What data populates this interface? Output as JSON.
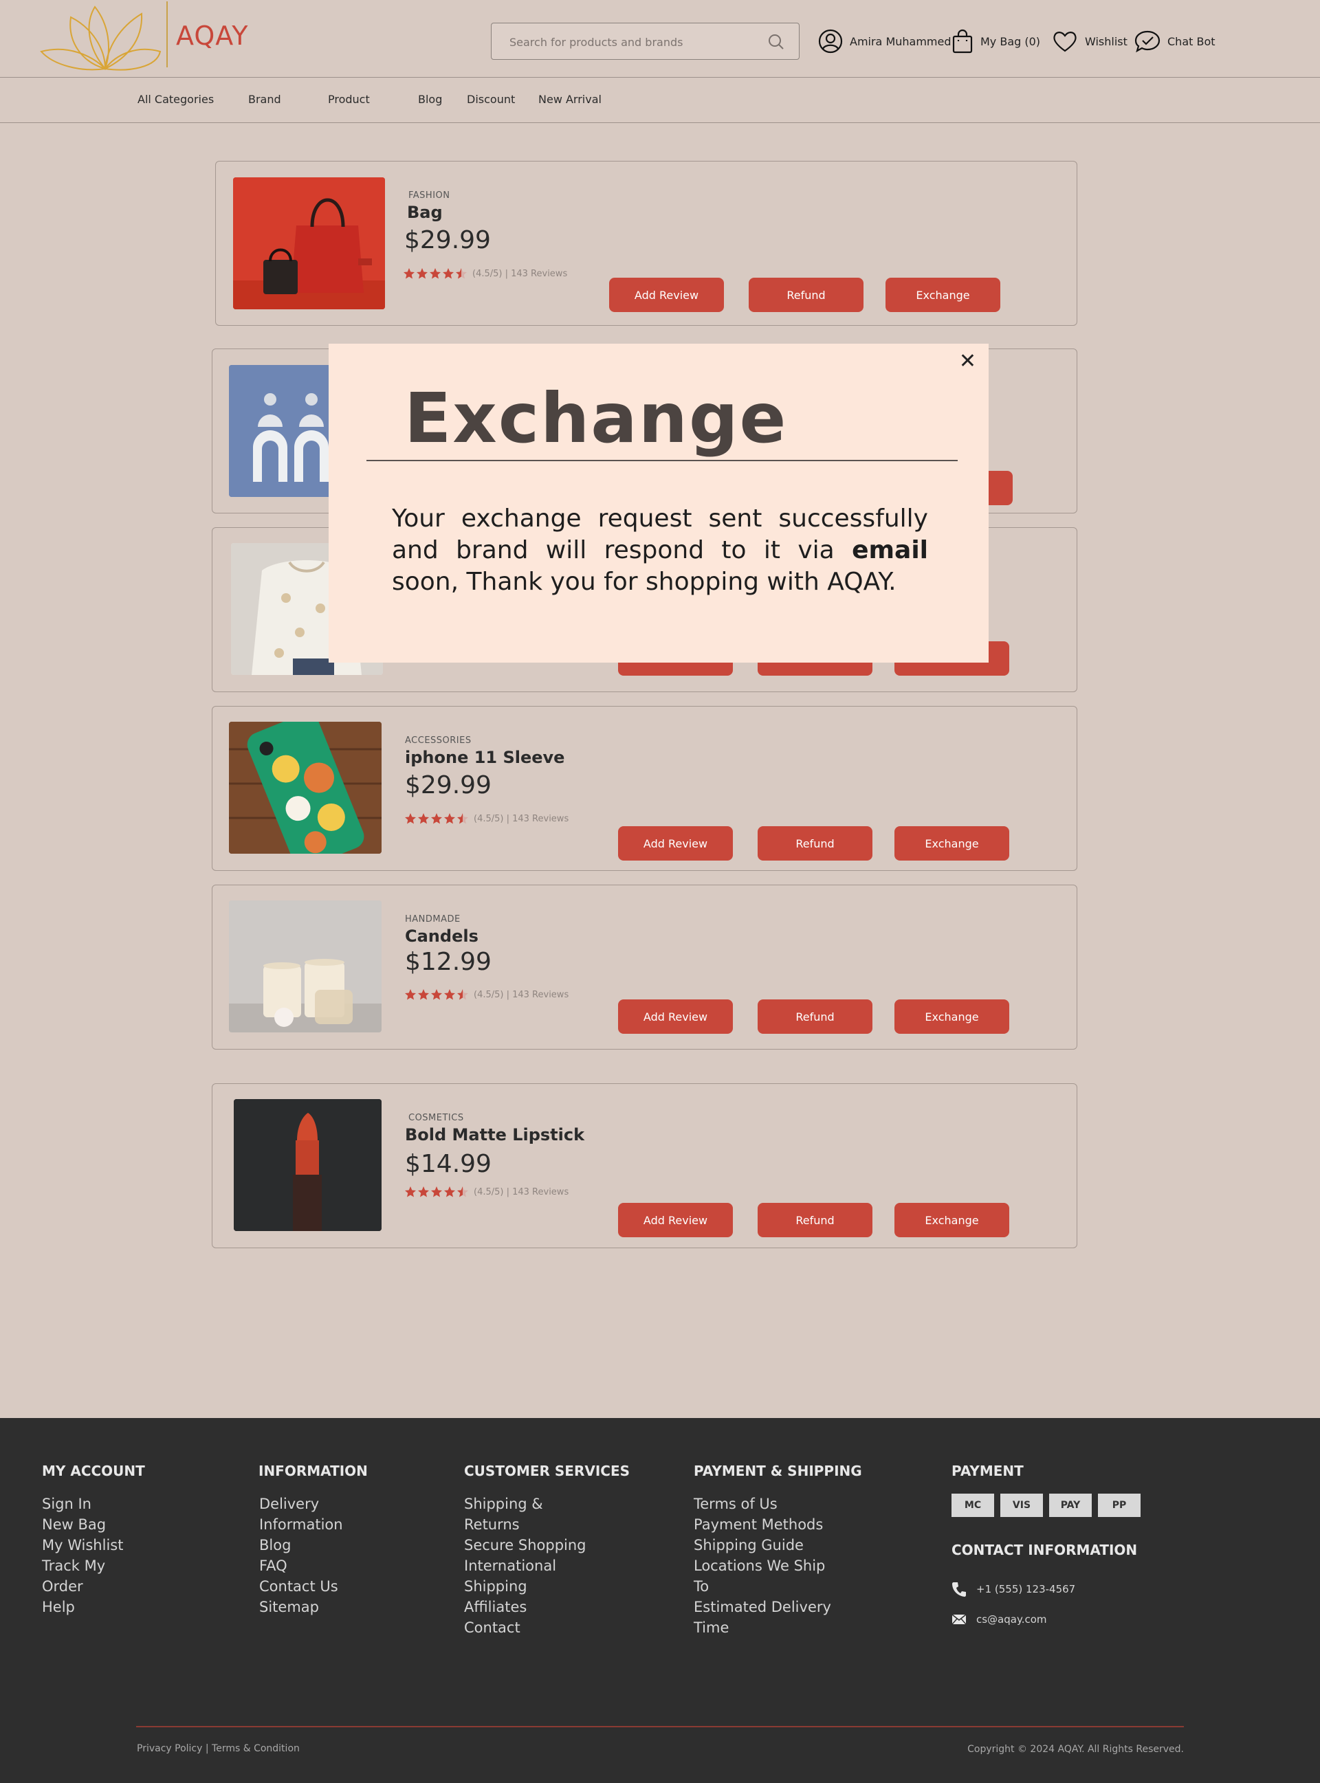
{
  "header": {
    "brand": "AQAY",
    "search_placeholder": "Search for products and brands",
    "user_name": "Amira Muhammed",
    "bag_label": "My Bag (0)",
    "wishlist_label": "Wishlist",
    "chatbot_label": "Chat Bot"
  },
  "nav": {
    "items": [
      "All Categories",
      "Brand",
      "Product",
      "Blog",
      "Discount",
      "New Arrival"
    ]
  },
  "orders": [
    {
      "category": "FASHION",
      "name": "Bag",
      "price": "$29.99",
      "rating": "(4.5/5) | 143 Reviews"
    },
    {
      "category": "",
      "name": "",
      "price": "",
      "rating": ""
    },
    {
      "category": "",
      "name": "",
      "price": "",
      "rating": ""
    },
    {
      "category": "ACCESSORIES",
      "name": "iphone 11 Sleeve",
      "price": "$29.99",
      "rating": "(4.5/5) | 143 Reviews"
    },
    {
      "category": "HANDMADE",
      "name": "Candels",
      "price": "$12.99",
      "rating": "(4.5/5) | 143 Reviews"
    },
    {
      "category": "COSMETICS",
      "name": "Bold Matte Lipstick",
      "price": "$14.99",
      "rating": "(4.5/5) | 143 Reviews"
    }
  ],
  "buttons": {
    "add_review": "Add Review",
    "refund": "Refund",
    "exchange": "Exchange"
  },
  "modal": {
    "title": "Exchange",
    "close": "✕",
    "message_part1": "Your exchange request sent successfully and brand will respond to it via ",
    "message_bold": "email",
    "message_part2": " soon, Thank you for shopping with ",
    "message_brand": "AQAY",
    "message_end": "."
  },
  "footer": {
    "my_account": {
      "title": "MY ACCOUNT",
      "items": [
        "Sign In",
        "New Bag",
        "My Wishlist",
        "Track My",
        "Order",
        "Help"
      ]
    },
    "information": {
      "title": "INFORMATION",
      "items": [
        "Delivery",
        "Information",
        "Blog",
        "FAQ",
        "Contact Us",
        "Sitemap"
      ]
    },
    "customer_services": {
      "title": "CUSTOMER SERVICES",
      "items": [
        "Shipping &",
        "Returns",
        "Secure Shopping",
        "International",
        "Shipping",
        "Affiliates",
        "Contact"
      ]
    },
    "payment_shipping": {
      "title": "PAYMENT & SHIPPING",
      "items": [
        "Terms of Us",
        "Payment Methods",
        "Shipping Guide",
        "Locations We Ship",
        "To",
        "Estimated Delivery",
        "Time"
      ]
    },
    "payment": {
      "title": "PAYMENT",
      "badges": [
        "MC",
        "VIS",
        "PAY",
        "PP"
      ]
    },
    "contact": {
      "title": "CONTACT INFORMATION",
      "phone": "+1 (555) 123-4567",
      "email": "cs@aqay.com"
    },
    "legal": "Privacy Policy  |  Terms & Condition",
    "copyright": "Copyright © 2024 AQAY. All Rights Reserved."
  },
  "colors": {
    "accent": "#c8473a",
    "background": "#d8cac2",
    "modal_bg": "#fde7da",
    "footer_bg": "#2e2e2e"
  }
}
